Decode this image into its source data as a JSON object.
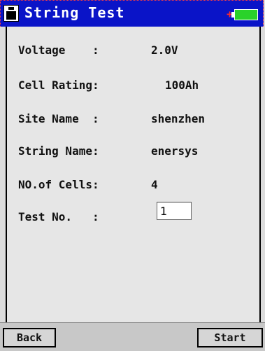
{
  "window": {
    "title": "String Test",
    "charge_symbol": "+"
  },
  "fields": {
    "voltage": {
      "label": "Voltage    :",
      "value": "2.0V"
    },
    "cell_rating": {
      "label": "Cell Rating:",
      "value": "100Ah"
    },
    "site_name": {
      "label": "Site Name  :",
      "value": "shenzhen"
    },
    "string_name": {
      "label": "String Name:",
      "value": "enersys"
    },
    "num_cells": {
      "label": "NO.of Cells:",
      "value": "4"
    },
    "test_no": {
      "label": "Test No.   :",
      "value": "1"
    }
  },
  "buttons": {
    "back_label": "Back",
    "start_label": "Start"
  },
  "colors": {
    "titlebar": "#0a14c8",
    "battery_fill": "#2ad22a",
    "charge_indicator": "#ff2a2a",
    "content_bg": "#e6e6e6",
    "bottombar_bg": "#c8c8c8"
  },
  "icons": {
    "app_icon": "floppy-disk-icon",
    "battery_icon": "battery-icon"
  }
}
